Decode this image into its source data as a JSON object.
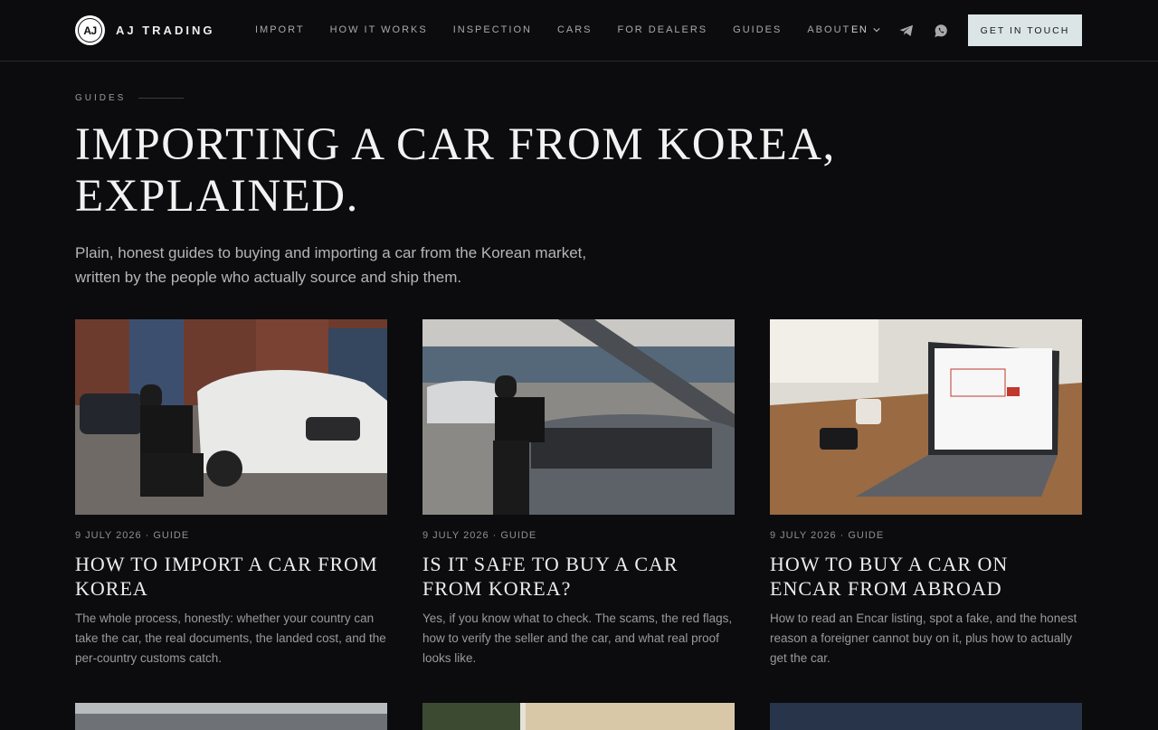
{
  "brand": {
    "mark": "AJ",
    "name": "AJ TRADING"
  },
  "nav": {
    "items": [
      "IMPORT",
      "HOW IT WORKS",
      "INSPECTION",
      "CARS",
      "FOR DEALERS",
      "GUIDES",
      "ABOUT"
    ],
    "language": "EN",
    "cta_label": "GET IN TOUCH",
    "icons": [
      "chevron-down-icon",
      "telegram-icon",
      "whatsapp-icon"
    ]
  },
  "hero": {
    "kicker": "GUIDES",
    "title": "Importing a car from Korea, explained.",
    "subtitle": "Plain, honest guides to buying and importing a car from the Korean market, written by the people who actually source and ship them."
  },
  "articles": [
    {
      "meta": "9 July 2026 · Guide",
      "title": "How to import a car from Korea",
      "excerpt": "The whole process, honestly: whether your country can take the car, the real documents, the landed cost, and the per-country customs catch."
    },
    {
      "meta": "9 July 2026 · Guide",
      "title": "Is it safe to buy a car from Korea?",
      "excerpt": "Yes, if you know what to check. The scams, the red flags, how to verify the seller and the car, and what real proof looks like."
    },
    {
      "meta": "9 July 2026 · Guide",
      "title": "How to buy a car on Encar from abroad",
      "excerpt": "How to read an Encar listing, spot a fake, and the honest reason a foreigner cannot buy on it, plus how to actually get the car."
    }
  ],
  "colors": {
    "background": "#0c0c0e",
    "cta_bg": "#dbe5e6",
    "text": "#ededed",
    "muted": "#9a9a9c"
  }
}
